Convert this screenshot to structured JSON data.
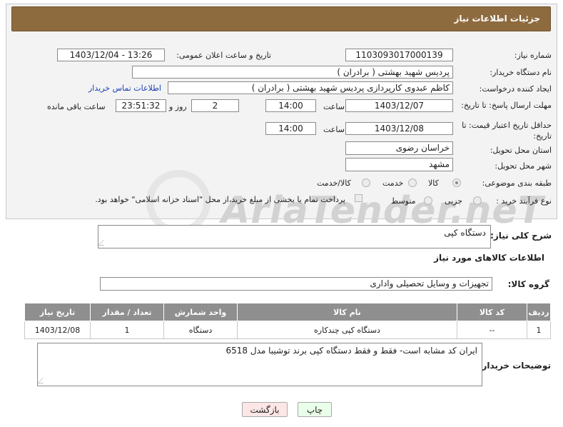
{
  "header": {
    "title": "جزئیات اطلاعات نیاز"
  },
  "watermark": "AriaTender.neT",
  "form": {
    "need_number": {
      "label": "شماره نیاز:",
      "value": "1103093017000139"
    },
    "announce_datetime": {
      "label": "تاریخ و ساعت اعلان عمومی:",
      "value": "1403/12/04 - 13:26"
    },
    "buyer_org": {
      "label": "نام دستگاه خریدار:",
      "value": "پردیس شهید بهشتی ( برادران )"
    },
    "requester": {
      "label": "ایجاد کننده درخواست:",
      "value": "کاظم  عبدوی  کارپردازی  پردیس شهید بهشتی ( برادران )",
      "contact_link": "اطلاعات تماس خریدار"
    },
    "reply_deadline": {
      "label": "مهلت ارسال پاسخ: تا تاریخ:",
      "date": "1403/12/07",
      "time_label": "ساعت",
      "time": "14:00",
      "days": "2",
      "days_label": "روز و",
      "remaining": "23:51:32",
      "remaining_label": "ساعت باقی مانده"
    },
    "price_validity": {
      "label": "حداقل تاریخ اعتبار قیمت: تا تاریخ:",
      "date": "1403/12/08",
      "time_label": "ساعت",
      "time": "14:00"
    },
    "province": {
      "label": "استان محل تحویل:",
      "value": "خراسان رضوی"
    },
    "city": {
      "label": "شهر محل تحویل:",
      "value": "مشهد"
    },
    "category": {
      "label": "طبقه بندی موضوعی:",
      "options": [
        "کالا",
        "خدمت",
        "کالا/خدمت"
      ],
      "selected": "کالا"
    },
    "purchase_type": {
      "label": "نوع فرآیند خرید :",
      "options": [
        "جزیی",
        "متوسط"
      ],
      "payment_note": "پرداخت تمام یا بخشی از مبلغ خرید،از محل \"اسناد خزانه اسلامی\" خواهد بود."
    }
  },
  "summary": {
    "label": "شرح کلی نیاز:",
    "value": "دستگاه کپی"
  },
  "goods_section": {
    "title": "اطلاعات کالاهای مورد نیاز"
  },
  "goods_group": {
    "label": "گروه کالا:",
    "value": "تجهیزات و وسایل تحصیلی واداری"
  },
  "table": {
    "headers": [
      "ردیف",
      "کد کالا",
      "نام کالا",
      "واحد شمارش",
      "تعداد / مقدار",
      "تاریخ نیاز"
    ],
    "rows": [
      [
        "1",
        "--",
        "دستگاه کپی چندکاره",
        "دستگاه",
        "1",
        "1403/12/08"
      ]
    ]
  },
  "buyer_notes": {
    "label": "توضیحات خریدار:",
    "value": "ایران کد مشابه است- فقط و فقط دستگاه کپی برند توشیبا مدل 6518"
  },
  "buttons": {
    "print": "چاپ",
    "back": "بازگشت"
  },
  "colors": {
    "title_bar": "#8e6b3f",
    "table_header": "#8f8f8f",
    "back_button": "#fde6e6",
    "print_button": "#eaffea",
    "link": "#1a3fb3"
  }
}
